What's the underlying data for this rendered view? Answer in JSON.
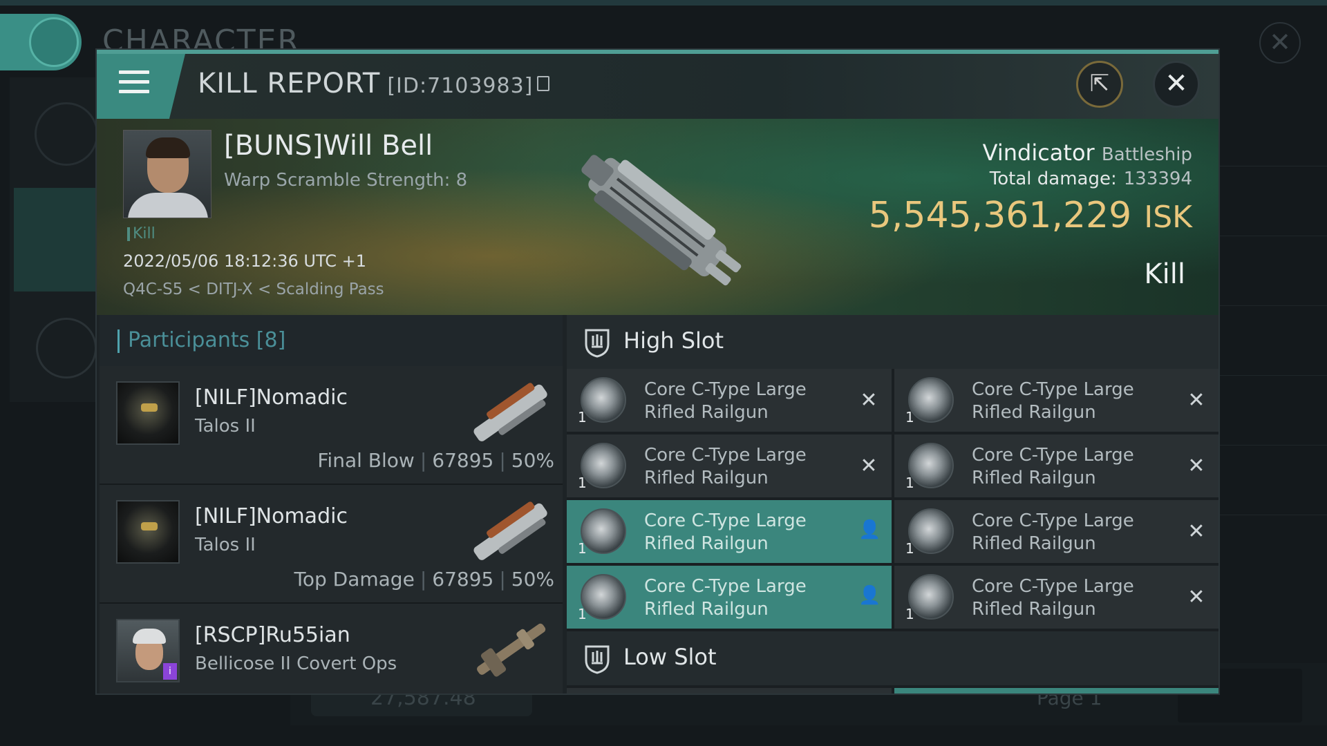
{
  "background": {
    "window_title": "CHARACTER",
    "bottom_value": "27,587.48",
    "bottom_page": "Page 1"
  },
  "window": {
    "title": "KILL REPORT",
    "report_id": "[ID:7103983]"
  },
  "victim": {
    "name": "[BUNS]Will Bell",
    "subtitle": "Warp Scramble Strength: 8",
    "tag": "Kill",
    "date": "2022/05/06 18:12:36 UTC +1",
    "location": "Q4C-S5 < DITJ-X < Scalding Pass",
    "ship_name": "Vindicator",
    "ship_class": "Battleship",
    "total_damage_label": "Total damage:",
    "total_damage": "133394",
    "isk_value": "5,545,361,229",
    "isk_unit": "ISK",
    "result": "Kill"
  },
  "participants": {
    "label": "Participants",
    "count": "[8]",
    "items": [
      {
        "name": "[NILF]Nomadic",
        "ship": "Talos II",
        "role": "Final Blow",
        "damage": "67895",
        "percent": "50%"
      },
      {
        "name": "[NILF]Nomadic",
        "ship": "Talos II",
        "role": "Top Damage",
        "damage": "67895",
        "percent": "50%"
      },
      {
        "name": "[RSCP]Ru55ian",
        "ship": "Bellicose II Covert Ops",
        "role": "",
        "damage": "",
        "percent": ""
      }
    ]
  },
  "fitting": {
    "high_slot_label": "High Slot",
    "low_slot_label": "Low Slot",
    "high_modules": [
      {
        "line1": "Core C-Type Large",
        "line2": "Rifled Railgun",
        "qty": "1",
        "state": "destroyed"
      },
      {
        "line1": "Core C-Type Large",
        "line2": "Rifled Railgun",
        "qty": "1",
        "state": "destroyed"
      },
      {
        "line1": "Core C-Type Large",
        "line2": "Rifled Railgun",
        "qty": "1",
        "state": "destroyed"
      },
      {
        "line1": "Core C-Type Large",
        "line2": "Rifled Railgun",
        "qty": "1",
        "state": "destroyed"
      },
      {
        "line1": "Core C-Type Large",
        "line2": "Rifled Railgun",
        "qty": "1",
        "state": "dropped"
      },
      {
        "line1": "Core C-Type Large",
        "line2": "Rifled Railgun",
        "qty": "1",
        "state": "destroyed"
      },
      {
        "line1": "Core C-Type Large",
        "line2": "Rifled Railgun",
        "qty": "1",
        "state": "dropped"
      },
      {
        "line1": "Core C-Type Large",
        "line2": "Rifled Railgun",
        "qty": "1",
        "state": "destroyed"
      }
    ]
  },
  "colors": {
    "accent": "#3a8a80",
    "isk": "#e9c77d",
    "participants_header": "#4a8f98",
    "dropped_module": "#3b867d"
  }
}
